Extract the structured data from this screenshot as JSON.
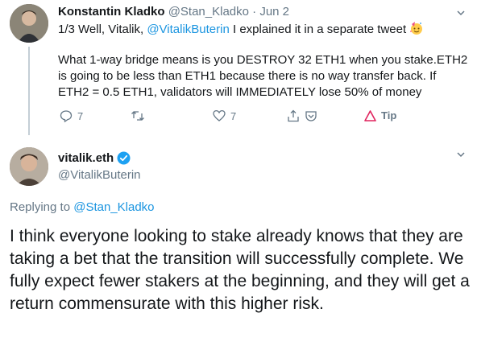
{
  "tweet1": {
    "display_name": "Konstantin Kladko",
    "handle": "@Stan_Kladko",
    "separator": " · ",
    "date": "Jun 2",
    "line1_prefix": "1/3 Well, Vitalik, ",
    "line1_mention": "@VitalikButerin",
    "line1_suffix": "  I explained it in a separate tweet",
    "body": "What 1-way bridge means is you DESTROY 32 ETH1 when you stake.ETH2 is going to be less than ETH1 because there is no way transfer back. If ETH2 = 0.5 ETH1, validators will IMMEDIATELY lose 50% of money",
    "reply_count": "7",
    "like_count": "7",
    "tip_label": "Tip",
    "tip_color": "#e0245e",
    "avatar_icon": "user-avatar"
  },
  "tweet2": {
    "display_name": "vitalik.eth",
    "handle": "@VitalikButerin",
    "replying_prefix": "Replying to ",
    "replying_mention": "@Stan_Kladko",
    "body": "I think everyone looking to stake already knows that they are taking a bet that the transition will successfully complete. We fully expect fewer stakers at the beginning, and they will get a return commensurate with this higher risk.",
    "verified_color": "#1da1f2",
    "avatar_icon": "user-avatar"
  },
  "colors": {
    "link": "#1b95e0",
    "secondary": "#657786",
    "text": "#14171a"
  }
}
